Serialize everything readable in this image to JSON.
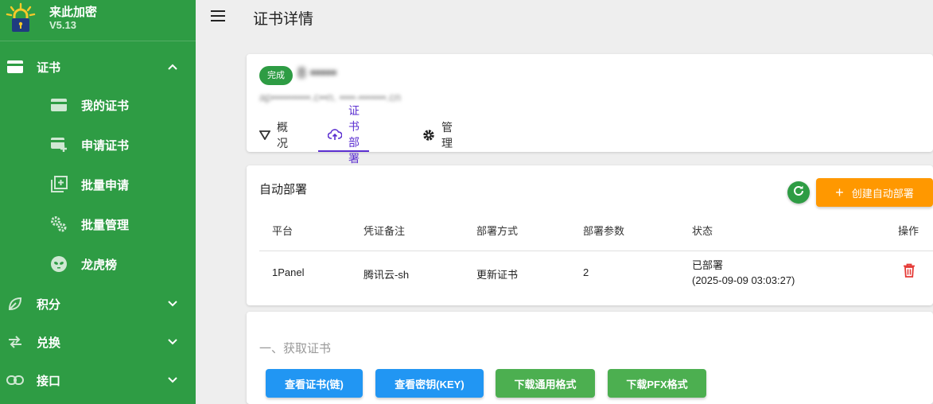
{
  "app": {
    "name": "来此加密",
    "version": "V5.13"
  },
  "sidebar": {
    "sections": [
      {
        "label": "证书",
        "icon": "card-icon",
        "expanded": true,
        "items": [
          {
            "label": "我的证书",
            "icon": "certificate-card-icon"
          },
          {
            "label": "申请证书",
            "icon": "card-add-icon"
          },
          {
            "label": "批量申请",
            "icon": "batch-copy-icon"
          },
          {
            "label": "批量管理",
            "icon": "cogs-icon"
          },
          {
            "label": "龙虎榜",
            "icon": "alien-icon"
          }
        ]
      },
      {
        "label": "积分",
        "icon": "leaf-icon",
        "expanded": false
      },
      {
        "label": "兑换",
        "icon": "swap-icon",
        "expanded": false
      },
      {
        "label": "接口",
        "icon": "link-icon",
        "expanded": false
      }
    ]
  },
  "header": {
    "title": "证书详情"
  },
  "certificate": {
    "status": "完成",
    "name": "8 •••••",
    "domain": "ap••••••••••.c••n.  ••••-•••••••.cn"
  },
  "tabs": [
    {
      "label": "概况",
      "icon": "filter-triangle-icon",
      "active": false
    },
    {
      "label": "证书部署",
      "icon": "cloud-upload-icon",
      "active": true
    },
    {
      "label": "管理",
      "icon": "gear-icon",
      "active": false
    }
  ],
  "deploy": {
    "title": "自动部署",
    "create_label": "创建自动部署",
    "columns": [
      "平台",
      "凭证备注",
      "部署方式",
      "部署参数",
      "状态",
      "操作"
    ],
    "rows": [
      {
        "platform": "1Panel",
        "credential": "腾讯云-sh",
        "method": "更新证书",
        "params": "2",
        "status": "已部署",
        "status_time": "(2025-09-09 03:03:27)"
      }
    ]
  },
  "fetch": {
    "title": "一、获取证书",
    "buttons": [
      "查看证书(链)",
      "查看密钥(KEY)",
      "下载通用格式",
      "下载PFX格式"
    ]
  },
  "colors": {
    "sidebar": "#2e9c44",
    "accent": "#5b2fd0",
    "orange": "#ff9800",
    "blue": "#2196f3",
    "green": "#4caf50",
    "danger": "#e53935"
  }
}
